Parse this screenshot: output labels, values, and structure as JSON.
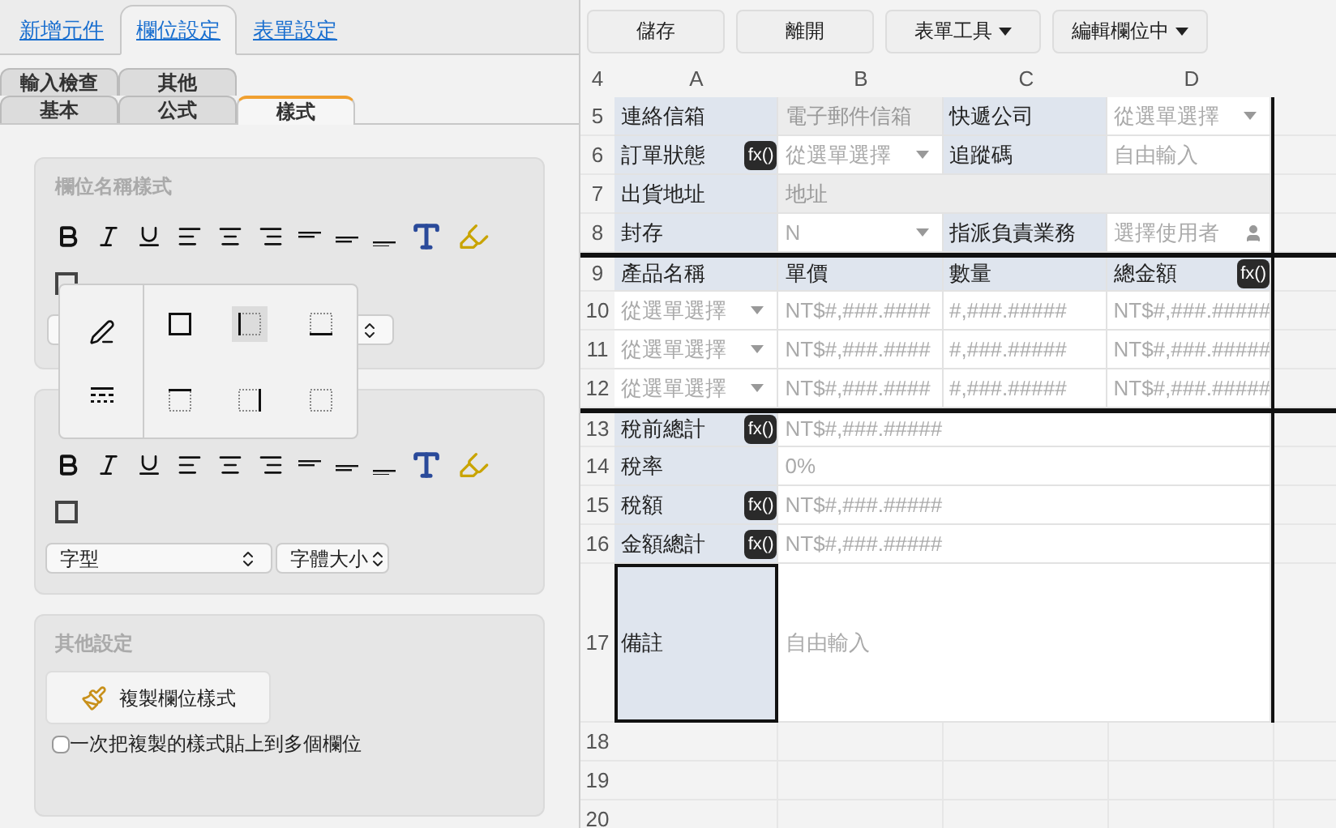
{
  "main_tabs": [
    {
      "label": "新增元件",
      "selected": false
    },
    {
      "label": "欄位設定",
      "selected": true
    },
    {
      "label": "表單設定",
      "selected": false
    }
  ],
  "sub_tabs": [
    [
      {
        "label": "輸入檢查",
        "selected": false
      },
      {
        "label": "其他",
        "selected": false
      }
    ],
    [
      {
        "label": "基本",
        "selected": false
      },
      {
        "label": "公式",
        "selected": false
      },
      {
        "label": "樣式",
        "selected": true
      }
    ]
  ],
  "name_style": {
    "title": "欄位名稱樣式",
    "border_checked": false
  },
  "border_menu": {
    "styles": [
      {
        "kind": "all",
        "selected": false
      },
      {
        "kind": "left",
        "selected": true
      },
      {
        "kind": "bottom",
        "selected": false
      },
      {
        "kind": "top",
        "selected": false
      },
      {
        "kind": "right",
        "selected": false
      },
      {
        "kind": "none",
        "selected": false
      }
    ]
  },
  "value_style": {
    "border_checked": false,
    "font_select": "字型",
    "size_select": "字體大小"
  },
  "other_settings": {
    "title": "其他設定",
    "copy_button": "複製欄位樣式",
    "multi_paste": {
      "label": "一次把複製的樣式貼上到多個欄位",
      "checked": false
    }
  },
  "toolbar": [
    {
      "label": "儲存",
      "menu": false
    },
    {
      "label": "離開",
      "menu": false
    },
    {
      "label": "表單工具",
      "menu": true
    },
    {
      "label": "編輯欄位中",
      "menu": true
    }
  ],
  "grid": {
    "header_row": "4",
    "columns": [
      "A",
      "B",
      "C",
      "D"
    ],
    "rows": [
      {
        "number": "5",
        "group_start": false,
        "cells": [
          {
            "kind": "label",
            "text": "連絡信箱",
            "selected": false
          },
          {
            "kind": "input",
            "text": "電子郵件信箱",
            "disabled": true,
            "selected": false
          },
          {
            "kind": "label",
            "text": "快遞公司",
            "selected": false
          },
          {
            "kind": "select",
            "text": "從選單選擇",
            "selected": false
          }
        ]
      },
      {
        "number": "6",
        "group_start": false,
        "cells": [
          {
            "kind": "label",
            "text": "訂單狀態",
            "formula": "fx()",
            "selected": false
          },
          {
            "kind": "select",
            "text": "從選單選擇",
            "selected": false
          },
          {
            "kind": "label",
            "text": "追蹤碼",
            "selected": false
          },
          {
            "kind": "input",
            "text": "自由輸入",
            "disabled": false,
            "selected": false
          }
        ]
      },
      {
        "number": "7",
        "group_start": false,
        "cells": [
          {
            "kind": "label",
            "text": "出貨地址",
            "selected": false
          },
          {
            "kind": "input",
            "text": "地址",
            "disabled": true,
            "selected": false
          }
        ]
      },
      {
        "number": "8",
        "group_start": false,
        "cells": [
          {
            "kind": "label",
            "text": "封存",
            "selected": false
          },
          {
            "kind": "select",
            "text": "N",
            "selected": false
          },
          {
            "kind": "label",
            "text": "指派負責業務",
            "selected": false
          },
          {
            "kind": "user",
            "text": "選擇使用者",
            "selected": false
          }
        ]
      },
      {
        "number": "9",
        "group_start": true,
        "cells": [
          {
            "kind": "label",
            "text": "產品名稱",
            "selected": false
          },
          {
            "kind": "label",
            "text": "單價",
            "selected": false
          },
          {
            "kind": "label",
            "text": "數量",
            "selected": false
          },
          {
            "kind": "label",
            "text": "總金額",
            "formula": "fx()",
            "selected": false
          }
        ]
      },
      {
        "number": "10",
        "group_start": false,
        "cells": [
          {
            "kind": "select",
            "text": "從選單選擇",
            "selected": false
          },
          {
            "kind": "input",
            "text": "NT$#,###.####",
            "disabled": false,
            "selected": false
          },
          {
            "kind": "input",
            "text": "#,###.#####",
            "disabled": false,
            "selected": false
          },
          {
            "kind": "input",
            "text": "NT$#,###.#####",
            "disabled": false,
            "selected": false
          }
        ]
      },
      {
        "number": "11",
        "group_start": false,
        "cells": [
          {
            "kind": "select",
            "text": "從選單選擇",
            "selected": false
          },
          {
            "kind": "input",
            "text": "NT$#,###.####",
            "disabled": false,
            "selected": false
          },
          {
            "kind": "input",
            "text": "#,###.#####",
            "disabled": false,
            "selected": false
          },
          {
            "kind": "input",
            "text": "NT$#,###.#####",
            "disabled": false,
            "selected": false
          }
        ]
      },
      {
        "number": "12",
        "group_start": false,
        "cells": [
          {
            "kind": "select",
            "text": "從選單選擇",
            "selected": false
          },
          {
            "kind": "input",
            "text": "NT$#,###.####",
            "disabled": false,
            "selected": false
          },
          {
            "kind": "input",
            "text": "#,###.#####",
            "disabled": false,
            "selected": false
          },
          {
            "kind": "input",
            "text": "NT$#,###.#####",
            "disabled": false,
            "selected": false
          }
        ]
      },
      {
        "number": "13",
        "group_start": true,
        "cells": [
          {
            "kind": "label",
            "text": "稅前總計",
            "formula": "fx()",
            "selected": false
          },
          {
            "kind": "input",
            "text": "NT$#,###.#####",
            "disabled": false,
            "selected": false
          }
        ]
      },
      {
        "number": "14",
        "group_start": false,
        "cells": [
          {
            "kind": "label",
            "text": "稅率",
            "selected": false
          },
          {
            "kind": "input",
            "text": "0%",
            "disabled": false,
            "selected": false
          }
        ]
      },
      {
        "number": "15",
        "group_start": false,
        "cells": [
          {
            "kind": "label",
            "text": "稅額",
            "formula": "fx()",
            "selected": false
          },
          {
            "kind": "input",
            "text": "NT$#,###.#####",
            "disabled": false,
            "selected": false
          }
        ]
      },
      {
        "number": "16",
        "group_start": false,
        "cells": [
          {
            "kind": "label",
            "text": "金額總計",
            "formula": "fx()",
            "selected": false
          },
          {
            "kind": "input",
            "text": "NT$#,###.#####",
            "disabled": false,
            "selected": false
          }
        ]
      },
      {
        "number": "17",
        "group_start": false,
        "cells": [
          {
            "kind": "label",
            "text": "備註",
            "selected": true
          },
          {
            "kind": "textarea",
            "text": "自由輸入",
            "disabled": false,
            "selected": false
          }
        ]
      },
      {
        "number": "18",
        "group_start": false,
        "cells": []
      },
      {
        "number": "19",
        "group_start": false,
        "cells": []
      },
      {
        "number": "20",
        "group_start": false,
        "cells": []
      }
    ]
  }
}
